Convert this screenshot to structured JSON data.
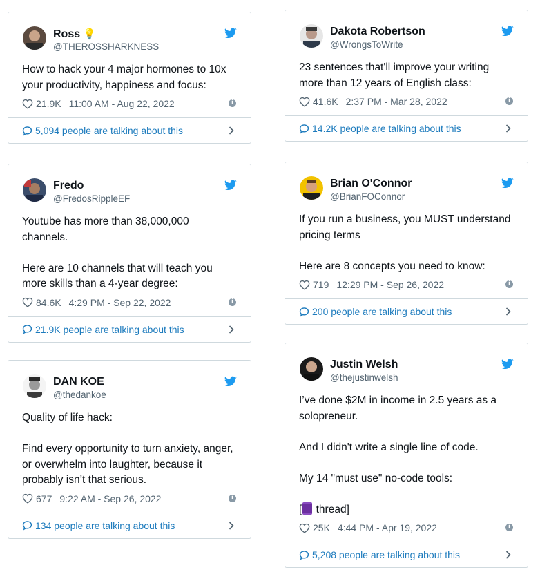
{
  "tweets": [
    {
      "name": "Ross",
      "name_suffix_icon": "lightbulb-icon",
      "handle": "@THEROSSHARKNESS",
      "paragraphs": [
        "How to hack your 4 major hormones to 10x your productivity, happiness and focus:"
      ],
      "likes": "21.9K",
      "timestamp": "11:00 AM - Aug 22, 2022",
      "talking": "5,094 people are talking about this"
    },
    {
      "name": "Dakota Robertson",
      "handle": "@WrongsToWrite",
      "paragraphs": [
        "23 sentences that'll improve your writing more than 12 years of English class:"
      ],
      "likes": "41.6K",
      "timestamp": "2:37 PM - Mar 28, 2022",
      "talking": "14.2K people are talking about this"
    },
    {
      "name": "Fredo",
      "handle": "@FredosRippleEF",
      "paragraphs": [
        "Youtube has more than 38,000,000 channels.",
        "Here are 10 channels that will teach you more skills than a 4-year degree:"
      ],
      "likes": "84.6K",
      "timestamp": "4:29 PM - Sep 22, 2022",
      "talking": "21.9K people are talking about this"
    },
    {
      "name": "Brian O'Connor",
      "handle": "@BrianFOConnor",
      "paragraphs": [
        "If you run a business, you MUST understand pricing terms",
        "Here are 8 concepts you need to know:"
      ],
      "likes": "719",
      "timestamp": "12:29 PM - Sep 26, 2022",
      "talking": "200 people are talking about this"
    },
    {
      "name": "DAN KOE",
      "handle": "@thedankoe",
      "paragraphs": [
        "Quality of life hack:",
        "Find every opportunity to turn anxiety, anger, or overwhelm into laughter, because it probably isn’t that serious."
      ],
      "likes": "677",
      "timestamp": "9:22 AM - Sep 26, 2022",
      "talking": "134 people are talking about this"
    },
    {
      "name": "Justin Welsh",
      "handle": "@thejustinwelsh",
      "paragraphs": [
        "I’ve done $2M in income in 2.5 years as a solopreneur.",
        "And I didn't write a single line of code.",
        "My 14 \"must use\" no-code tools:"
      ],
      "thread_open": "[",
      "thread_icon": "thread-spool-emoji",
      "thread_close": " thread]",
      "likes": "25K",
      "timestamp": "4:44 PM - Apr 19, 2022",
      "talking": "5,208 people are talking about this"
    }
  ],
  "colors": {
    "link": "#1d7bbd",
    "twitter_blue": "#1d9bf0",
    "muted": "#536471",
    "border": "#cfd9de"
  }
}
